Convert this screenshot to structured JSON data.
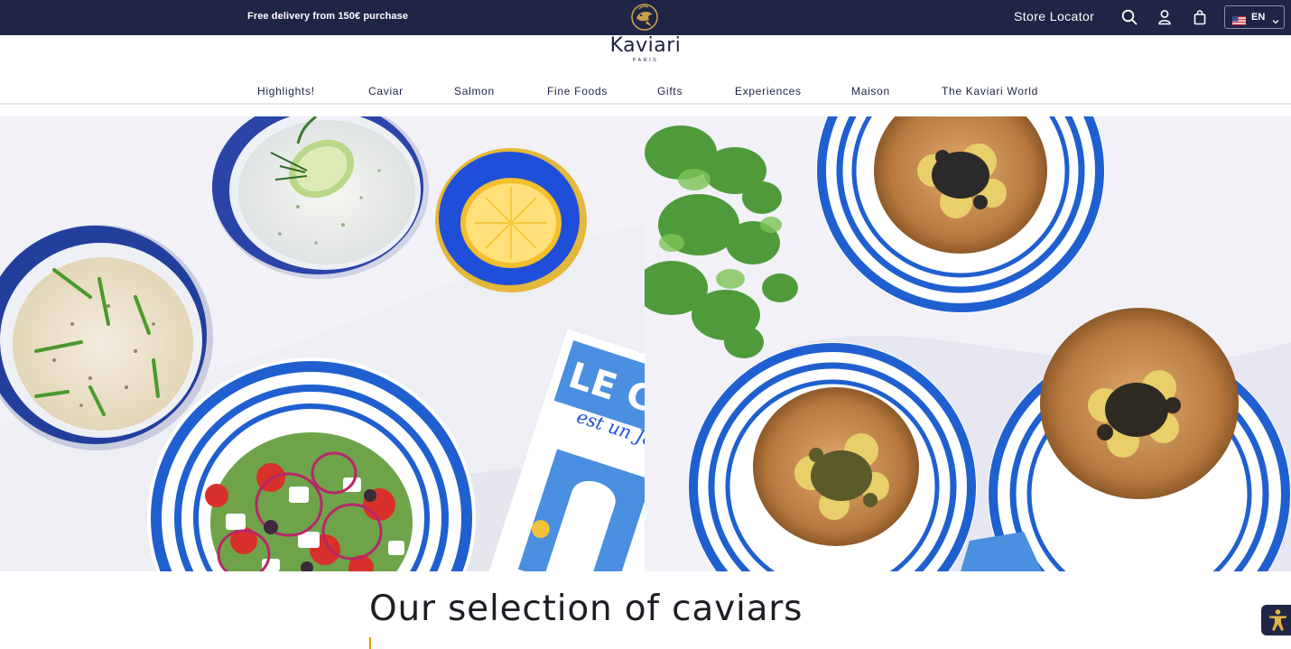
{
  "topbar": {
    "promo_text": "Free delivery from 150€ purchase",
    "store_locator_label": "Store Locator",
    "language_code": "EN",
    "colors": {
      "background": "#1f2545",
      "text": "#ffffff",
      "emblem_gold": "#c8a04a"
    }
  },
  "logo": {
    "wordmark": "Kaviari",
    "subtitle": "PARIS"
  },
  "nav": {
    "items": [
      "Highlights!",
      "Caviar",
      "Salmon",
      "Fine Foods",
      "Gifts",
      "Experiences",
      "Maison",
      "The Kaviari World"
    ]
  },
  "hero": {
    "left_image": "mezze-dishes-lemon-and-caviar-magazine",
    "right_image": "striped-plates-with-potatoes-and-caviar",
    "magazine_text": "LE CAVIA",
    "magazine_script": "est un Joy",
    "colors": {
      "table": "#eeeef5",
      "stripe_blue": "#1f5fd0",
      "wood": "#c48a4e"
    }
  },
  "section": {
    "title": "Our selection of caviars",
    "accent_color": "#d9a100"
  },
  "icons": {
    "emblem": "kaviari-fish-emblem-icon",
    "search": "search-icon",
    "account": "user-icon",
    "bag": "shopping-bag-icon",
    "flag": "us-flag-icon",
    "chevron": "chevron-down-icon",
    "accessibility": "accessibility-icon"
  }
}
